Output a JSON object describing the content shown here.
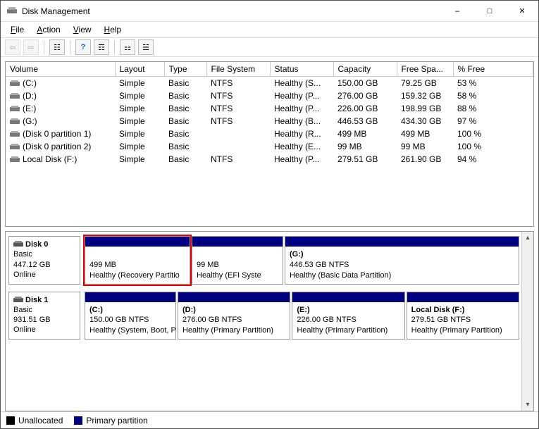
{
  "window": {
    "title": "Disk Management"
  },
  "menu": {
    "file": "File",
    "action": "Action",
    "view": "View",
    "help": "Help"
  },
  "columns": {
    "volume": "Volume",
    "layout": "Layout",
    "type": "Type",
    "fs": "File System",
    "status": "Status",
    "capacity": "Capacity",
    "free": "Free Spa...",
    "pct": "% Free"
  },
  "volumes": [
    {
      "name": "(C:)",
      "layout": "Simple",
      "type": "Basic",
      "fs": "NTFS",
      "status": "Healthy (S...",
      "capacity": "150.00 GB",
      "free": "79.25 GB",
      "pct": "53 %"
    },
    {
      "name": "(D:)",
      "layout": "Simple",
      "type": "Basic",
      "fs": "NTFS",
      "status": "Healthy (P...",
      "capacity": "276.00 GB",
      "free": "159.32 GB",
      "pct": "58 %"
    },
    {
      "name": "(E:)",
      "layout": "Simple",
      "type": "Basic",
      "fs": "NTFS",
      "status": "Healthy (P...",
      "capacity": "226.00 GB",
      "free": "198.99 GB",
      "pct": "88 %"
    },
    {
      "name": "(G:)",
      "layout": "Simple",
      "type": "Basic",
      "fs": "NTFS",
      "status": "Healthy (B...",
      "capacity": "446.53 GB",
      "free": "434.30 GB",
      "pct": "97 %"
    },
    {
      "name": "(Disk 0 partition 1)",
      "layout": "Simple",
      "type": "Basic",
      "fs": "",
      "status": "Healthy (R...",
      "capacity": "499 MB",
      "free": "499 MB",
      "pct": "100 %"
    },
    {
      "name": "(Disk 0 partition 2)",
      "layout": "Simple",
      "type": "Basic",
      "fs": "",
      "status": "Healthy (E...",
      "capacity": "99 MB",
      "free": "99 MB",
      "pct": "100 %"
    },
    {
      "name": "Local Disk (F:)",
      "layout": "Simple",
      "type": "Basic",
      "fs": "NTFS",
      "status": "Healthy (P...",
      "capacity": "279.51 GB",
      "free": "261.90 GB",
      "pct": "94 %"
    }
  ],
  "disks": [
    {
      "name": "Disk 0",
      "type": "Basic",
      "size": "447.12 GB",
      "status": "Online",
      "partitions": [
        {
          "label": "",
          "size": "499 MB",
          "desc": "Healthy (Recovery Partitio",
          "flex": "0 0 150px",
          "highlight": true
        },
        {
          "label": "",
          "size": "99 MB",
          "desc": "Healthy (EFI Syste",
          "flex": "0 0 130px",
          "highlight": false
        },
        {
          "label": "(G:)",
          "size": "446.53 GB NTFS",
          "desc": "Healthy (Basic Data Partition)",
          "flex": "1 1 auto",
          "highlight": false
        }
      ]
    },
    {
      "name": "Disk 1",
      "type": "Basic",
      "size": "931.51 GB",
      "status": "Online",
      "partitions": [
        {
          "label": "(C:)",
          "size": "150.00 GB NTFS",
          "desc": "Healthy (System, Boot, Pa",
          "flex": "0 0 130px",
          "highlight": false
        },
        {
          "label": "(D:)",
          "size": "276.00 GB NTFS",
          "desc": "Healthy (Primary Partition)",
          "flex": "1 1 0",
          "highlight": false
        },
        {
          "label": "(E:)",
          "size": "226.00 GB NTFS",
          "desc": "Healthy (Primary Partition)",
          "flex": "1 1 0",
          "highlight": false
        },
        {
          "label": "Local Disk  (F:)",
          "size": "279.51 GB NTFS",
          "desc": "Healthy (Primary Partition)",
          "flex": "1 1 0",
          "highlight": false
        }
      ]
    }
  ],
  "legend": {
    "unallocated": "Unallocated",
    "primary": "Primary partition"
  },
  "colors": {
    "primary": "#000080",
    "unallocated": "#000000",
    "highlight": "#e60000"
  }
}
